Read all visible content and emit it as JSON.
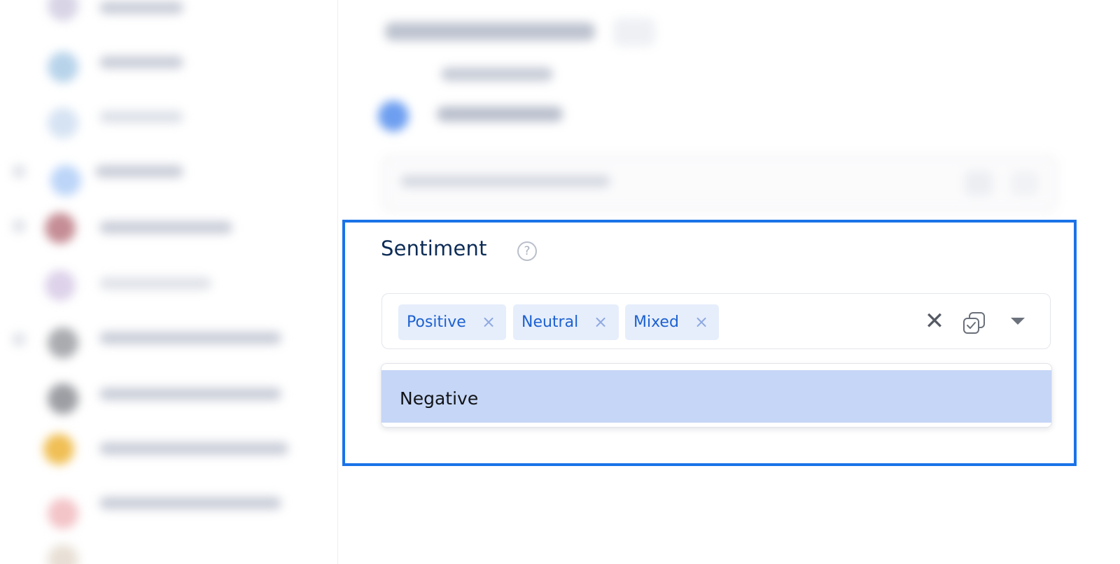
{
  "sentiment": {
    "label": "Sentiment",
    "help_glyph": "?",
    "selected_tags": [
      {
        "label": "Positive",
        "remove_glyph": "×"
      },
      {
        "label": "Neutral",
        "remove_glyph": "×"
      },
      {
        "label": "Mixed",
        "remove_glyph": "×"
      }
    ],
    "clear_glyph": "✕",
    "dropdown_options": [
      {
        "label": "Negative",
        "highlighted": true
      }
    ]
  },
  "colors": {
    "focus_border": "#1a73e8",
    "tag_background": "#e6eefc",
    "tag_text": "#1d61d0",
    "option_highlight": "#c6d6f6",
    "label_text": "#0d2c56"
  },
  "icons": [
    "help-circle-icon",
    "remove-tag-icon",
    "clear-all-icon",
    "select-all-icon",
    "dropdown-caret-icon"
  ]
}
